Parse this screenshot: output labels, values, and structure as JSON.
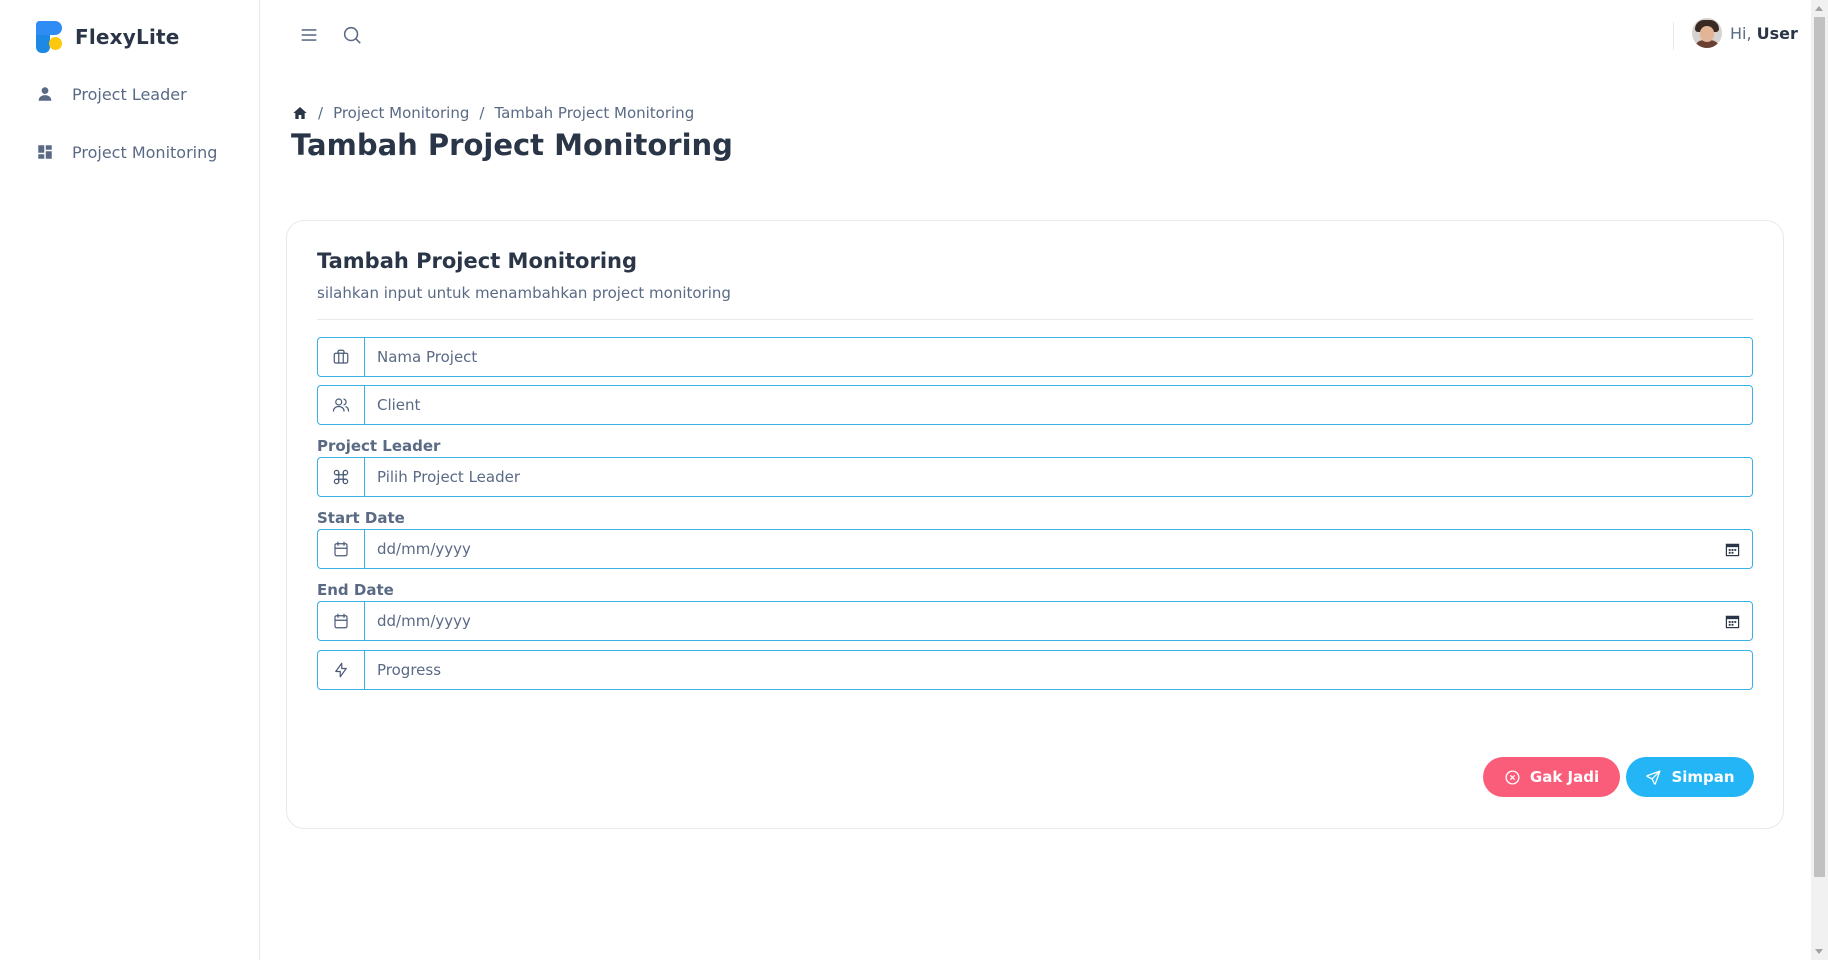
{
  "brand": {
    "name": "FlexyLite"
  },
  "sidebar": {
    "items": [
      {
        "label": "Project Leader",
        "icon": "user-icon"
      },
      {
        "label": "Project Monitoring",
        "icon": "dashboard-icon"
      }
    ]
  },
  "header": {
    "greeting": "Hi,",
    "username": "User"
  },
  "breadcrumb": {
    "items": [
      "Project Monitoring",
      "Tambah Project Monitoring"
    ],
    "separator": "/"
  },
  "page": {
    "title": "Tambah Project Monitoring"
  },
  "form": {
    "title": "Tambah Project Monitoring",
    "subtitle": "silahkan input untuk menambahkan project monitoring",
    "nama_project": {
      "placeholder": "Nama Project",
      "value": ""
    },
    "client": {
      "placeholder": "Client",
      "value": ""
    },
    "project_leader": {
      "label": "Project Leader",
      "placeholder": "Pilih Project Leader",
      "value": ""
    },
    "start_date": {
      "label": "Start Date",
      "placeholder": "dd/mm/yyyy",
      "value": ""
    },
    "end_date": {
      "label": "End Date",
      "placeholder": "dd/mm/yyyy",
      "value": ""
    },
    "progress": {
      "placeholder": "Progress",
      "value": ""
    },
    "cancel_label": "Gak Jadi",
    "save_label": "Simpan"
  },
  "colors": {
    "primary": "#23b5f5",
    "danger": "#fa5d7a",
    "input_border": "#39b1e8",
    "text_dark": "#2a3547",
    "text_muted": "#5a6a85"
  }
}
